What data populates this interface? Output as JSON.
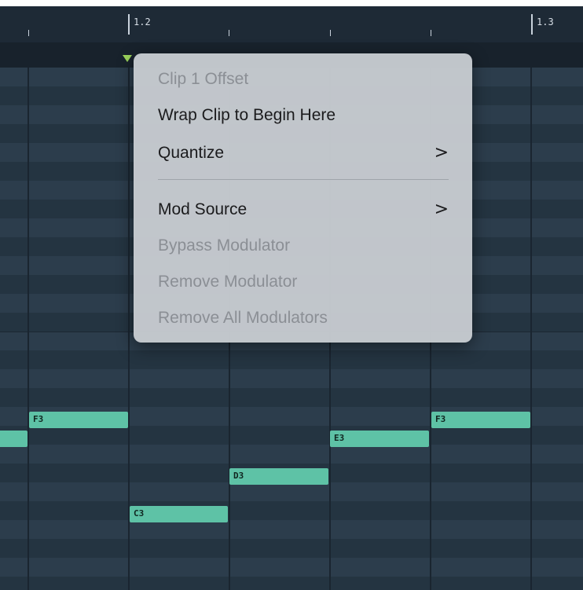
{
  "ruler": {
    "bar_labels": [
      "1.2",
      "1.3"
    ]
  },
  "context_menu": {
    "items": [
      {
        "label": "Clip 1 Offset",
        "enabled": false,
        "submenu": false
      },
      {
        "label": "Wrap Clip to Begin Here",
        "enabled": true,
        "submenu": false
      },
      {
        "label": "Quantize",
        "enabled": true,
        "submenu": true,
        "chevron": ">"
      },
      {
        "label": "Mod Source",
        "enabled": true,
        "submenu": true,
        "chevron": ">"
      },
      {
        "label": "Bypass Modulator",
        "enabled": false,
        "submenu": false
      },
      {
        "label": "Remove Modulator",
        "enabled": false,
        "submenu": false
      },
      {
        "label": "Remove All Modulators",
        "enabled": false,
        "submenu": false
      }
    ]
  },
  "notes": [
    {
      "label": "",
      "pitch": "F3-partial"
    },
    {
      "label": "F3",
      "pitch": "F3"
    },
    {
      "label": "C3",
      "pitch": "C3"
    },
    {
      "label": "D3",
      "pitch": "D3"
    },
    {
      "label": "E3",
      "pitch": "E3"
    },
    {
      "label": "F3",
      "pitch": "F3"
    }
  ],
  "colors": {
    "note_fill": "#5ec2a6",
    "grid_light": "#2c3d4c",
    "grid_dark": "#243441",
    "playhead": "#9bd35c",
    "menu_bg": "#c6cad0"
  }
}
